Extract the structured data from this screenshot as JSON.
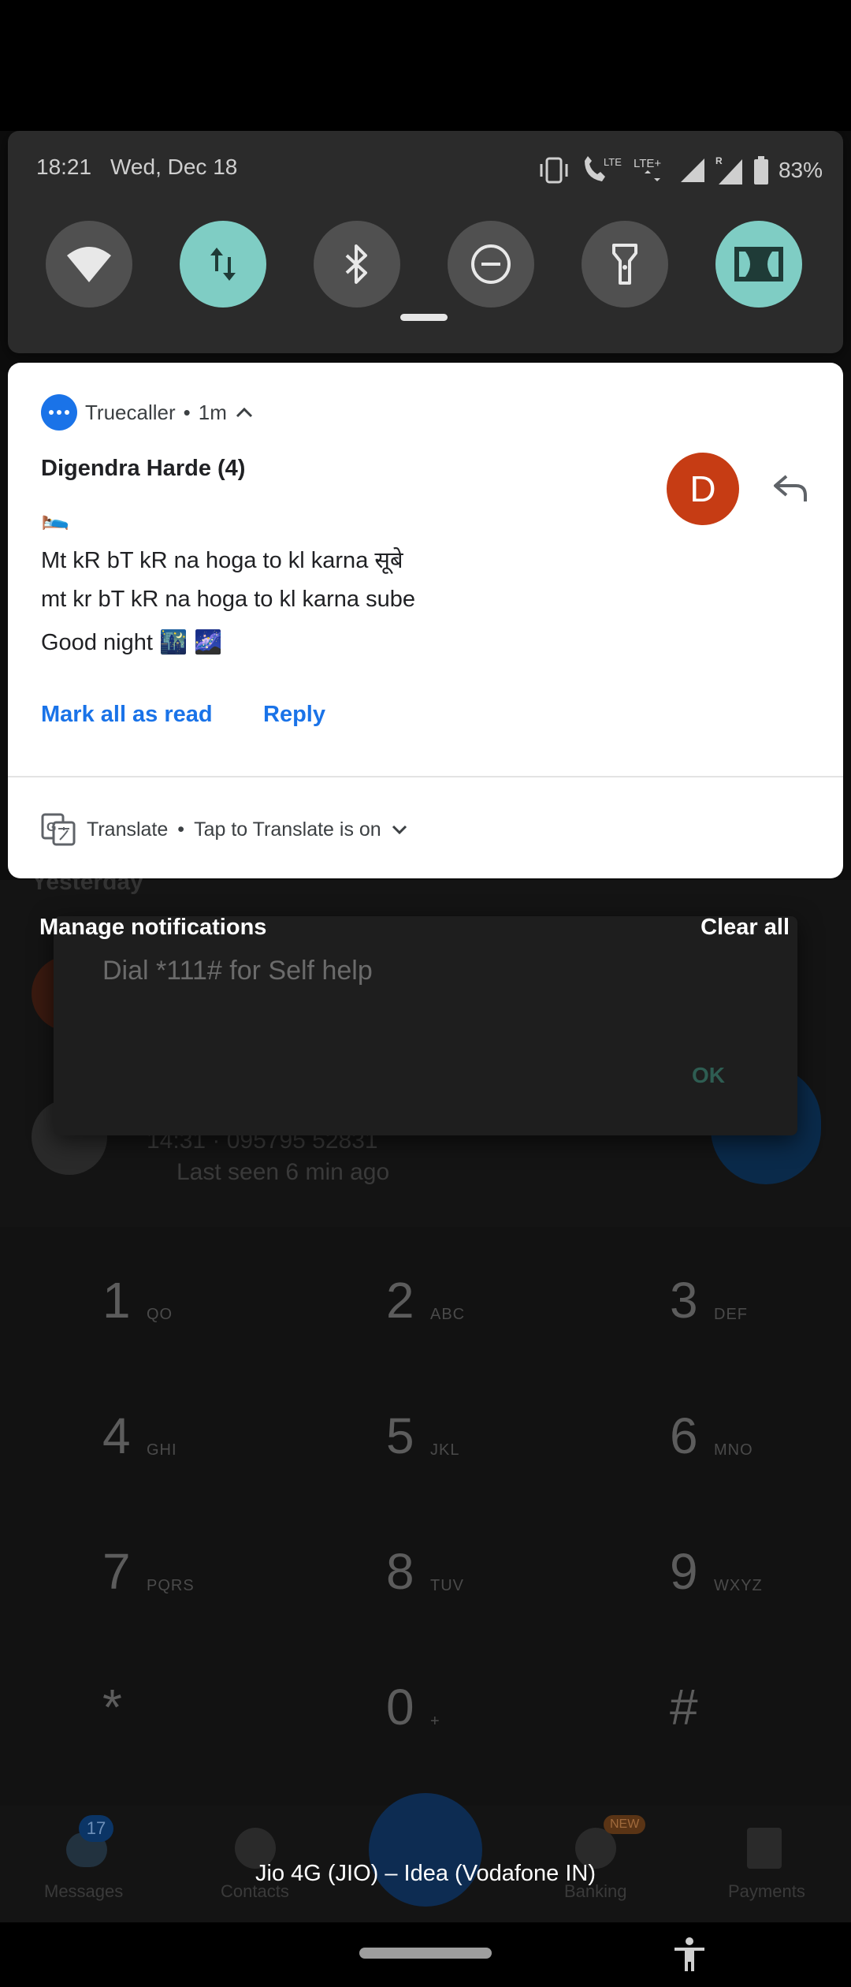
{
  "status_bar": {
    "time": "18:21",
    "date": "Wed, Dec 18",
    "lte1": "LTE",
    "lte2": "LTE+",
    "roaming": "R",
    "battery": "83%"
  },
  "quick_settings": {
    "tiles": [
      {
        "name": "wifi",
        "active": false
      },
      {
        "name": "mobile-data",
        "active": true
      },
      {
        "name": "bluetooth",
        "active": false
      },
      {
        "name": "do-not-disturb",
        "active": false
      },
      {
        "name": "flashlight",
        "active": false
      },
      {
        "name": "dolby",
        "active": true
      }
    ],
    "accent": "#7fcdc4"
  },
  "notification": {
    "app_name": "Truecaller",
    "dot": "•",
    "time": "1m",
    "sender": "Digendra Harde (4)",
    "avatar_letter": "D",
    "avatar_color": "#c63c14",
    "lines": [
      "🛌",
      "Mt kR bT kR na hoga to kl karna सूबे",
      "mt kr bT kR na hoga to kl karna sube",
      "Good night 🌃 🌌"
    ],
    "actions": [
      "Mark all as read",
      "Reply"
    ],
    "action_color": "#1a73e8"
  },
  "translate_notification": {
    "app_name": "Translate",
    "dot": "•",
    "text": "Tap to Translate is on"
  },
  "footer": {
    "manage": "Manage notifications",
    "clear_all": "Clear all",
    "carrier": "Jio 4G (JIO) – Idea (Vodafone IN)"
  },
  "background_app": {
    "section_header": "Yesterday",
    "dialog_message": "Dial *111# for Self help",
    "dialog_ok": "OK",
    "call_line": "14:31 · 095795 52831",
    "last_seen": "Last seen 6 min ago",
    "keypad": [
      {
        "digit": "1",
        "letters": "QO"
      },
      {
        "digit": "2",
        "letters": "ABC"
      },
      {
        "digit": "3",
        "letters": "DEF"
      },
      {
        "digit": "4",
        "letters": "GHI"
      },
      {
        "digit": "5",
        "letters": "JKL"
      },
      {
        "digit": "6",
        "letters": "MNO"
      },
      {
        "digit": "7",
        "letters": "PQRS"
      },
      {
        "digit": "8",
        "letters": "TUV"
      },
      {
        "digit": "9",
        "letters": "WXYZ"
      },
      {
        "digit": "*",
        "letters": ""
      },
      {
        "digit": "0",
        "letters": "+"
      },
      {
        "digit": "#",
        "letters": ""
      }
    ],
    "bottom_nav": {
      "messages": "Messages",
      "messages_badge": "17",
      "contacts": "Contacts",
      "banking": "Banking",
      "banking_badge": "NEW",
      "payments": "Payments"
    }
  }
}
